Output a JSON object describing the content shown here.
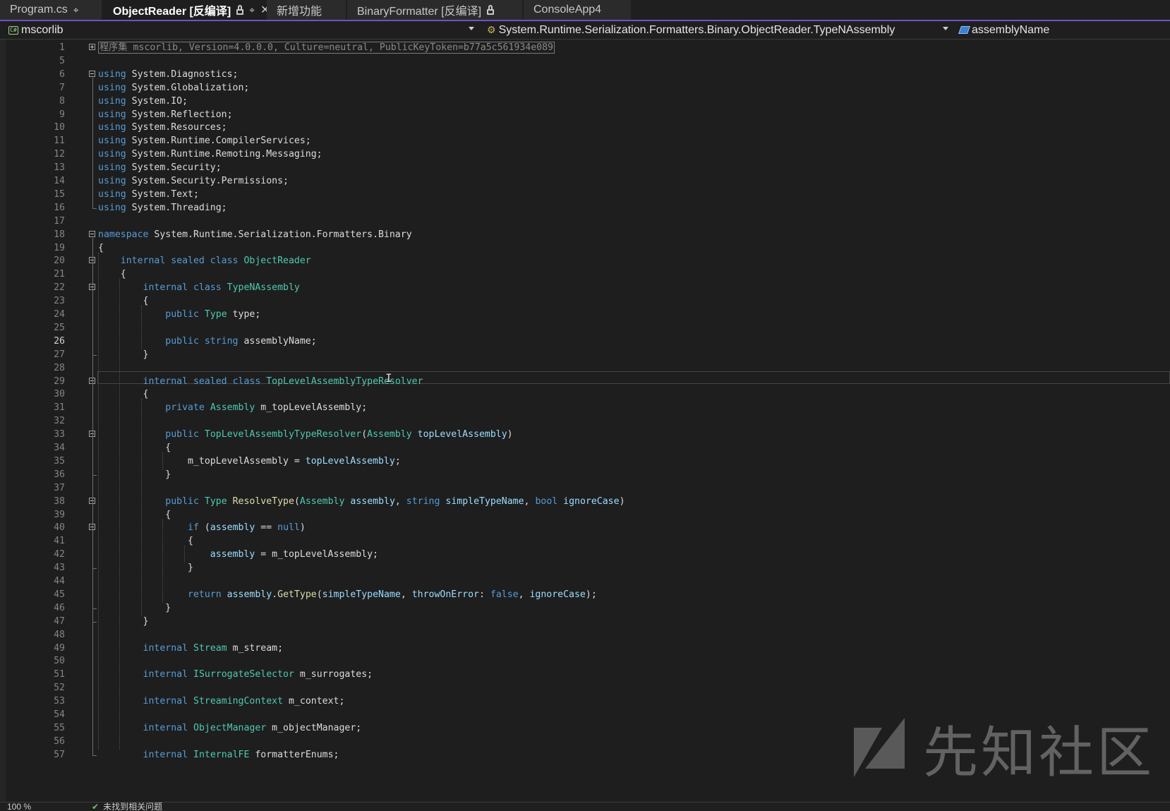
{
  "tabs": [
    {
      "label": "Program.cs",
      "icons": [
        "pin-icon"
      ]
    },
    {
      "label": "ObjectReader [反编译]",
      "active": true,
      "icons": [
        "lock-icon",
        "pin-icon",
        "close-icon"
      ]
    },
    {
      "label": "新增功能",
      "icons": []
    },
    {
      "label": "BinaryFormatter [反编译]",
      "icons": [
        "lock-icon"
      ]
    },
    {
      "label": "ConsoleApp4",
      "icons": []
    }
  ],
  "navbar": {
    "project": "mscorlib",
    "type": "System.Runtime.Serialization.Formatters.Binary.ObjectReader.TypeNAssembly",
    "member": "assemblyName"
  },
  "editor": {
    "current_line": 26,
    "lines": [
      {
        "n": "1",
        "tokens": [
          [
            "g",
            "程序集 mscorlib, Version=4.0.0.0, Culture=neutral, PublicKeyToken=b77a5c561934e089"
          ]
        ]
      },
      {
        "n": "5",
        "tokens": []
      },
      {
        "n": "6",
        "tokens": [
          [
            "k",
            "using"
          ],
          [
            "p",
            " System.Diagnostics;"
          ]
        ]
      },
      {
        "n": "7",
        "tokens": [
          [
            "k",
            "using"
          ],
          [
            "p",
            " System.Globalization;"
          ]
        ]
      },
      {
        "n": "8",
        "tokens": [
          [
            "k",
            "using"
          ],
          [
            "p",
            " System.IO;"
          ]
        ]
      },
      {
        "n": "9",
        "tokens": [
          [
            "k",
            "using"
          ],
          [
            "p",
            " System.Reflection;"
          ]
        ]
      },
      {
        "n": "10",
        "tokens": [
          [
            "k",
            "using"
          ],
          [
            "p",
            " System.Resources;"
          ]
        ]
      },
      {
        "n": "11",
        "tokens": [
          [
            "k",
            "using"
          ],
          [
            "p",
            " System.Runtime.CompilerServices;"
          ]
        ]
      },
      {
        "n": "12",
        "tokens": [
          [
            "k",
            "using"
          ],
          [
            "p",
            " System.Runtime.Remoting.Messaging;"
          ]
        ]
      },
      {
        "n": "13",
        "tokens": [
          [
            "k",
            "using"
          ],
          [
            "p",
            " System.Security;"
          ]
        ]
      },
      {
        "n": "14",
        "tokens": [
          [
            "k",
            "using"
          ],
          [
            "p",
            " System.Security.Permissions;"
          ]
        ]
      },
      {
        "n": "15",
        "tokens": [
          [
            "k",
            "using"
          ],
          [
            "p",
            " System.Text;"
          ]
        ]
      },
      {
        "n": "16",
        "tokens": [
          [
            "k",
            "using"
          ],
          [
            "p",
            " System.Threading;"
          ]
        ]
      },
      {
        "n": "17",
        "tokens": []
      },
      {
        "n": "18",
        "tokens": [
          [
            "k",
            "namespace"
          ],
          [
            "p",
            " System.Runtime.Serialization.Formatters.Binary"
          ]
        ]
      },
      {
        "n": "19",
        "tokens": [
          [
            "p",
            "{"
          ]
        ]
      },
      {
        "n": "20",
        "tokens": [
          [
            "p",
            "    "
          ],
          [
            "k",
            "internal sealed class"
          ],
          [
            "p",
            " "
          ],
          [
            "t",
            "ObjectReader"
          ]
        ]
      },
      {
        "n": "21",
        "tokens": [
          [
            "p",
            "    {"
          ]
        ]
      },
      {
        "n": "22",
        "tokens": [
          [
            "p",
            "        "
          ],
          [
            "k",
            "internal class"
          ],
          [
            "p",
            " "
          ],
          [
            "t",
            "TypeNAssembly"
          ]
        ]
      },
      {
        "n": "23",
        "tokens": [
          [
            "p",
            "        {"
          ]
        ]
      },
      {
        "n": "24",
        "tokens": [
          [
            "p",
            "            "
          ],
          [
            "k",
            "public"
          ],
          [
            "p",
            " "
          ],
          [
            "t",
            "Type"
          ],
          [
            "p",
            " type;"
          ]
        ]
      },
      {
        "n": "25",
        "tokens": []
      },
      {
        "n": "26",
        "tokens": [
          [
            "p",
            "            "
          ],
          [
            "k",
            "public string"
          ],
          [
            "p",
            " assemblyName;"
          ]
        ]
      },
      {
        "n": "27",
        "tokens": [
          [
            "p",
            "        }"
          ]
        ]
      },
      {
        "n": "28",
        "tokens": []
      },
      {
        "n": "29",
        "tokens": [
          [
            "p",
            "        "
          ],
          [
            "k",
            "internal sealed class"
          ],
          [
            "p",
            " "
          ],
          [
            "t",
            "TopLevelAssemblyTypeResolver"
          ]
        ]
      },
      {
        "n": "30",
        "tokens": [
          [
            "p",
            "        {"
          ]
        ]
      },
      {
        "n": "31",
        "tokens": [
          [
            "p",
            "            "
          ],
          [
            "k",
            "private"
          ],
          [
            "p",
            " "
          ],
          [
            "t",
            "Assembly"
          ],
          [
            "p",
            " m_topLevelAssembly;"
          ]
        ]
      },
      {
        "n": "32",
        "tokens": []
      },
      {
        "n": "33",
        "tokens": [
          [
            "p",
            "            "
          ],
          [
            "k",
            "public"
          ],
          [
            "p",
            " "
          ],
          [
            "t",
            "TopLevelAssemblyTypeResolver"
          ],
          [
            "p",
            "("
          ],
          [
            "t",
            "Assembly"
          ],
          [
            "p",
            " "
          ],
          [
            "v",
            "topLevelAssembly"
          ],
          [
            "p",
            ")"
          ]
        ]
      },
      {
        "n": "34",
        "tokens": [
          [
            "p",
            "            {"
          ]
        ]
      },
      {
        "n": "35",
        "tokens": [
          [
            "p",
            "                m_topLevelAssembly = "
          ],
          [
            "v",
            "topLevelAssembly"
          ],
          [
            "p",
            ";"
          ]
        ]
      },
      {
        "n": "36",
        "tokens": [
          [
            "p",
            "            }"
          ]
        ]
      },
      {
        "n": "37",
        "tokens": []
      },
      {
        "n": "38",
        "tokens": [
          [
            "p",
            "            "
          ],
          [
            "k",
            "public"
          ],
          [
            "p",
            " "
          ],
          [
            "t",
            "Type"
          ],
          [
            "p",
            " "
          ],
          [
            "m",
            "ResolveType"
          ],
          [
            "p",
            "("
          ],
          [
            "t",
            "Assembly"
          ],
          [
            "p",
            " "
          ],
          [
            "v",
            "assembly"
          ],
          [
            "p",
            ", "
          ],
          [
            "k",
            "string"
          ],
          [
            "p",
            " "
          ],
          [
            "v",
            "simpleTypeName"
          ],
          [
            "p",
            ", "
          ],
          [
            "k",
            "bool"
          ],
          [
            "p",
            " "
          ],
          [
            "v",
            "ignoreCase"
          ],
          [
            "p",
            ")"
          ]
        ]
      },
      {
        "n": "39",
        "tokens": [
          [
            "p",
            "            {"
          ]
        ]
      },
      {
        "n": "40",
        "tokens": [
          [
            "p",
            "                "
          ],
          [
            "k",
            "if"
          ],
          [
            "p",
            " ("
          ],
          [
            "v",
            "assembly"
          ],
          [
            "p",
            " == "
          ],
          [
            "k",
            "null"
          ],
          [
            "p",
            ")"
          ]
        ]
      },
      {
        "n": "41",
        "tokens": [
          [
            "p",
            "                {"
          ]
        ]
      },
      {
        "n": "42",
        "tokens": [
          [
            "p",
            "                    "
          ],
          [
            "v",
            "assembly"
          ],
          [
            "p",
            " = m_topLevelAssembly;"
          ]
        ]
      },
      {
        "n": "43",
        "tokens": [
          [
            "p",
            "                }"
          ]
        ]
      },
      {
        "n": "44",
        "tokens": []
      },
      {
        "n": "45",
        "tokens": [
          [
            "p",
            "                "
          ],
          [
            "k",
            "return"
          ],
          [
            "p",
            " "
          ],
          [
            "v",
            "assembly"
          ],
          [
            "p",
            "."
          ],
          [
            "m",
            "GetType"
          ],
          [
            "p",
            "("
          ],
          [
            "v",
            "simpleTypeName"
          ],
          [
            "p",
            ", "
          ],
          [
            "v",
            "throwOnError"
          ],
          [
            "p",
            ": "
          ],
          [
            "k",
            "false"
          ],
          [
            "p",
            ", "
          ],
          [
            "v",
            "ignoreCase"
          ],
          [
            "p",
            ");"
          ]
        ]
      },
      {
        "n": "46",
        "tokens": [
          [
            "p",
            "            }"
          ]
        ]
      },
      {
        "n": "47",
        "tokens": [
          [
            "p",
            "        }"
          ]
        ]
      },
      {
        "n": "48",
        "tokens": []
      },
      {
        "n": "49",
        "tokens": [
          [
            "p",
            "        "
          ],
          [
            "k",
            "internal"
          ],
          [
            "p",
            " "
          ],
          [
            "t",
            "Stream"
          ],
          [
            "p",
            " m_stream;"
          ]
        ]
      },
      {
        "n": "50",
        "tokens": []
      },
      {
        "n": "51",
        "tokens": [
          [
            "p",
            "        "
          ],
          [
            "k",
            "internal"
          ],
          [
            "p",
            " "
          ],
          [
            "t",
            "ISurrogateSelector"
          ],
          [
            "p",
            " m_surrogates;"
          ]
        ]
      },
      {
        "n": "52",
        "tokens": []
      },
      {
        "n": "53",
        "tokens": [
          [
            "p",
            "        "
          ],
          [
            "k",
            "internal"
          ],
          [
            "p",
            " "
          ],
          [
            "t",
            "StreamingContext"
          ],
          [
            "p",
            " m_context;"
          ]
        ]
      },
      {
        "n": "54",
        "tokens": []
      },
      {
        "n": "55",
        "tokens": [
          [
            "p",
            "        "
          ],
          [
            "k",
            "internal"
          ],
          [
            "p",
            " "
          ],
          [
            "t",
            "ObjectManager"
          ],
          [
            "p",
            " m_objectManager;"
          ]
        ]
      },
      {
        "n": "56",
        "tokens": []
      },
      {
        "n": "57",
        "tokens": [
          [
            "p",
            "        "
          ],
          [
            "k",
            "internal"
          ],
          [
            "p",
            " "
          ],
          [
            "t",
            "InternalFE"
          ],
          [
            "p",
            " formatterEnums;"
          ]
        ]
      }
    ]
  },
  "watermark": {
    "text": "先知社区"
  },
  "statusbar": {
    "zoom": "100 %",
    "issues": "未找到相关问题"
  },
  "colors": {
    "background": "#1e1e1e",
    "keyword": "#569cd6",
    "type": "#4ec9b0",
    "method": "#dcdcaa",
    "variable": "#9cdcfe",
    "text": "#dcdcdc",
    "accent": "#6f51c9"
  }
}
